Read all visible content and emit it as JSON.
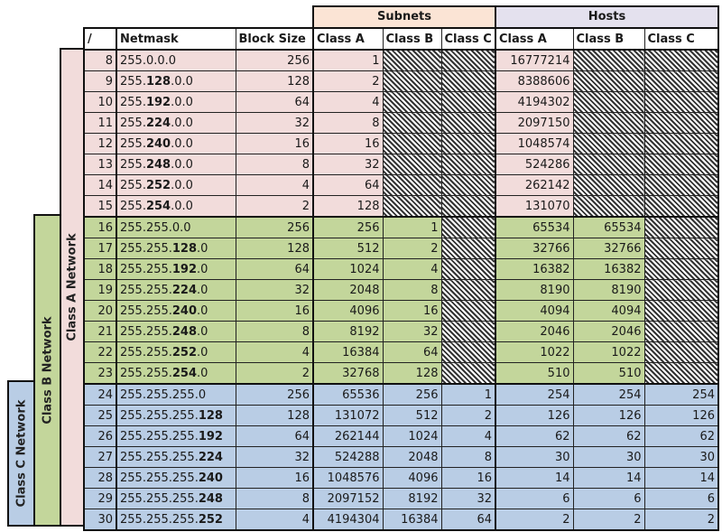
{
  "group_headers": {
    "subnets": "Subnets",
    "hosts": "Hosts"
  },
  "columns": [
    "/",
    "Netmask",
    "Block Size",
    "Class A",
    "Class B",
    "Class C",
    "Class A",
    "Class B",
    "Class C"
  ],
  "band_labels": {
    "class_a": "Class A Network",
    "class_b": "Class B Network",
    "class_c": "Class C Network"
  },
  "colors": {
    "class_a": "#f2dcdb",
    "class_b": "#c3d69b",
    "class_c": "#b9cde5",
    "subnets_header": "#fbe4d5",
    "hosts_header": "#e4e1ee"
  },
  "rows": [
    {
      "group": "a",
      "cidr": "8",
      "mask_plain": "255.",
      "mask_bold": "",
      "mask_tail": "0.0.0",
      "block": "256",
      "sub_a": "1",
      "sub_b": null,
      "sub_c": null,
      "host_a": "16777214",
      "host_b": null,
      "host_c": null
    },
    {
      "group": "a",
      "cidr": "9",
      "mask_plain": "255.",
      "mask_bold": "128",
      "mask_tail": ".0.0",
      "block": "128",
      "sub_a": "2",
      "sub_b": null,
      "sub_c": null,
      "host_a": "8388606",
      "host_b": null,
      "host_c": null
    },
    {
      "group": "a",
      "cidr": "10",
      "mask_plain": "255.",
      "mask_bold": "192",
      "mask_tail": ".0.0",
      "block": "64",
      "sub_a": "4",
      "sub_b": null,
      "sub_c": null,
      "host_a": "4194302",
      "host_b": null,
      "host_c": null
    },
    {
      "group": "a",
      "cidr": "11",
      "mask_plain": "255.",
      "mask_bold": "224",
      "mask_tail": ".0.0",
      "block": "32",
      "sub_a": "8",
      "sub_b": null,
      "sub_c": null,
      "host_a": "2097150",
      "host_b": null,
      "host_c": null
    },
    {
      "group": "a",
      "cidr": "12",
      "mask_plain": "255.",
      "mask_bold": "240",
      "mask_tail": ".0.0",
      "block": "16",
      "sub_a": "16",
      "sub_b": null,
      "sub_c": null,
      "host_a": "1048574",
      "host_b": null,
      "host_c": null
    },
    {
      "group": "a",
      "cidr": "13",
      "mask_plain": "255.",
      "mask_bold": "248",
      "mask_tail": ".0.0",
      "block": "8",
      "sub_a": "32",
      "sub_b": null,
      "sub_c": null,
      "host_a": "524286",
      "host_b": null,
      "host_c": null
    },
    {
      "group": "a",
      "cidr": "14",
      "mask_plain": "255.",
      "mask_bold": "252",
      "mask_tail": ".0.0",
      "block": "4",
      "sub_a": "64",
      "sub_b": null,
      "sub_c": null,
      "host_a": "262142",
      "host_b": null,
      "host_c": null
    },
    {
      "group": "a",
      "cidr": "15",
      "mask_plain": "255.",
      "mask_bold": "254",
      "mask_tail": ".0.0",
      "block": "2",
      "sub_a": "128",
      "sub_b": null,
      "sub_c": null,
      "host_a": "131070",
      "host_b": null,
      "host_c": null
    },
    {
      "group": "b",
      "cidr": "16",
      "mask_plain": "255.255.0.0",
      "mask_bold": "",
      "mask_tail": "",
      "block": "256",
      "sub_a": "256",
      "sub_b": "1",
      "sub_c": null,
      "host_a": "65534",
      "host_b": "65534",
      "host_c": null
    },
    {
      "group": "b",
      "cidr": "17",
      "mask_plain": "255.255.",
      "mask_bold": "128",
      "mask_tail": ".0",
      "block": "128",
      "sub_a": "512",
      "sub_b": "2",
      "sub_c": null,
      "host_a": "32766",
      "host_b": "32766",
      "host_c": null
    },
    {
      "group": "b",
      "cidr": "18",
      "mask_plain": "255.255.",
      "mask_bold": "192",
      "mask_tail": ".0",
      "block": "64",
      "sub_a": "1024",
      "sub_b": "4",
      "sub_c": null,
      "host_a": "16382",
      "host_b": "16382",
      "host_c": null
    },
    {
      "group": "b",
      "cidr": "19",
      "mask_plain": "255.255.",
      "mask_bold": "224",
      "mask_tail": ".0",
      "block": "32",
      "sub_a": "2048",
      "sub_b": "8",
      "sub_c": null,
      "host_a": "8190",
      "host_b": "8190",
      "host_c": null
    },
    {
      "group": "b",
      "cidr": "20",
      "mask_plain": "255.255.",
      "mask_bold": "240",
      "mask_tail": ".0",
      "block": "16",
      "sub_a": "4096",
      "sub_b": "16",
      "sub_c": null,
      "host_a": "4094",
      "host_b": "4094",
      "host_c": null
    },
    {
      "group": "b",
      "cidr": "21",
      "mask_plain": "255.255.",
      "mask_bold": "248",
      "mask_tail": ".0",
      "block": "8",
      "sub_a": "8192",
      "sub_b": "32",
      "sub_c": null,
      "host_a": "2046",
      "host_b": "2046",
      "host_c": null
    },
    {
      "group": "b",
      "cidr": "22",
      "mask_plain": "255.255.",
      "mask_bold": "252",
      "mask_tail": ".0",
      "block": "4",
      "sub_a": "16384",
      "sub_b": "64",
      "sub_c": null,
      "host_a": "1022",
      "host_b": "1022",
      "host_c": null
    },
    {
      "group": "b",
      "cidr": "23",
      "mask_plain": "255.255.",
      "mask_bold": "254",
      "mask_tail": ".0",
      "block": "2",
      "sub_a": "32768",
      "sub_b": "128",
      "sub_c": null,
      "host_a": "510",
      "host_b": "510",
      "host_c": null
    },
    {
      "group": "c",
      "cidr": "24",
      "mask_plain": "255.255.255.0",
      "mask_bold": "",
      "mask_tail": "",
      "block": "256",
      "sub_a": "65536",
      "sub_b": "256",
      "sub_c": "1",
      "host_a": "254",
      "host_b": "254",
      "host_c": "254"
    },
    {
      "group": "c",
      "cidr": "25",
      "mask_plain": "255.255.255.",
      "mask_bold": "128",
      "mask_tail": "",
      "block": "128",
      "sub_a": "131072",
      "sub_b": "512",
      "sub_c": "2",
      "host_a": "126",
      "host_b": "126",
      "host_c": "126"
    },
    {
      "group": "c",
      "cidr": "26",
      "mask_plain": "255.255.255.",
      "mask_bold": "192",
      "mask_tail": "",
      "block": "64",
      "sub_a": "262144",
      "sub_b": "1024",
      "sub_c": "4",
      "host_a": "62",
      "host_b": "62",
      "host_c": "62"
    },
    {
      "group": "c",
      "cidr": "27",
      "mask_plain": "255.255.255.",
      "mask_bold": "224",
      "mask_tail": "",
      "block": "32",
      "sub_a": "524288",
      "sub_b": "2048",
      "sub_c": "8",
      "host_a": "30",
      "host_b": "30",
      "host_c": "30"
    },
    {
      "group": "c",
      "cidr": "28",
      "mask_plain": "255.255.255.",
      "mask_bold": "240",
      "mask_tail": "",
      "block": "16",
      "sub_a": "1048576",
      "sub_b": "4096",
      "sub_c": "16",
      "host_a": "14",
      "host_b": "14",
      "host_c": "14"
    },
    {
      "group": "c",
      "cidr": "29",
      "mask_plain": "255.255.255.",
      "mask_bold": "248",
      "mask_tail": "",
      "block": "8",
      "sub_a": "2097152",
      "sub_b": "8192",
      "sub_c": "32",
      "host_a": "6",
      "host_b": "6",
      "host_c": "6"
    },
    {
      "group": "c",
      "cidr": "30",
      "mask_plain": "255.255.255.",
      "mask_bold": "252",
      "mask_tail": "",
      "block": "4",
      "sub_a": "4194304",
      "sub_b": "16384",
      "sub_c": "64",
      "host_a": "2",
      "host_b": "2",
      "host_c": "2"
    }
  ]
}
